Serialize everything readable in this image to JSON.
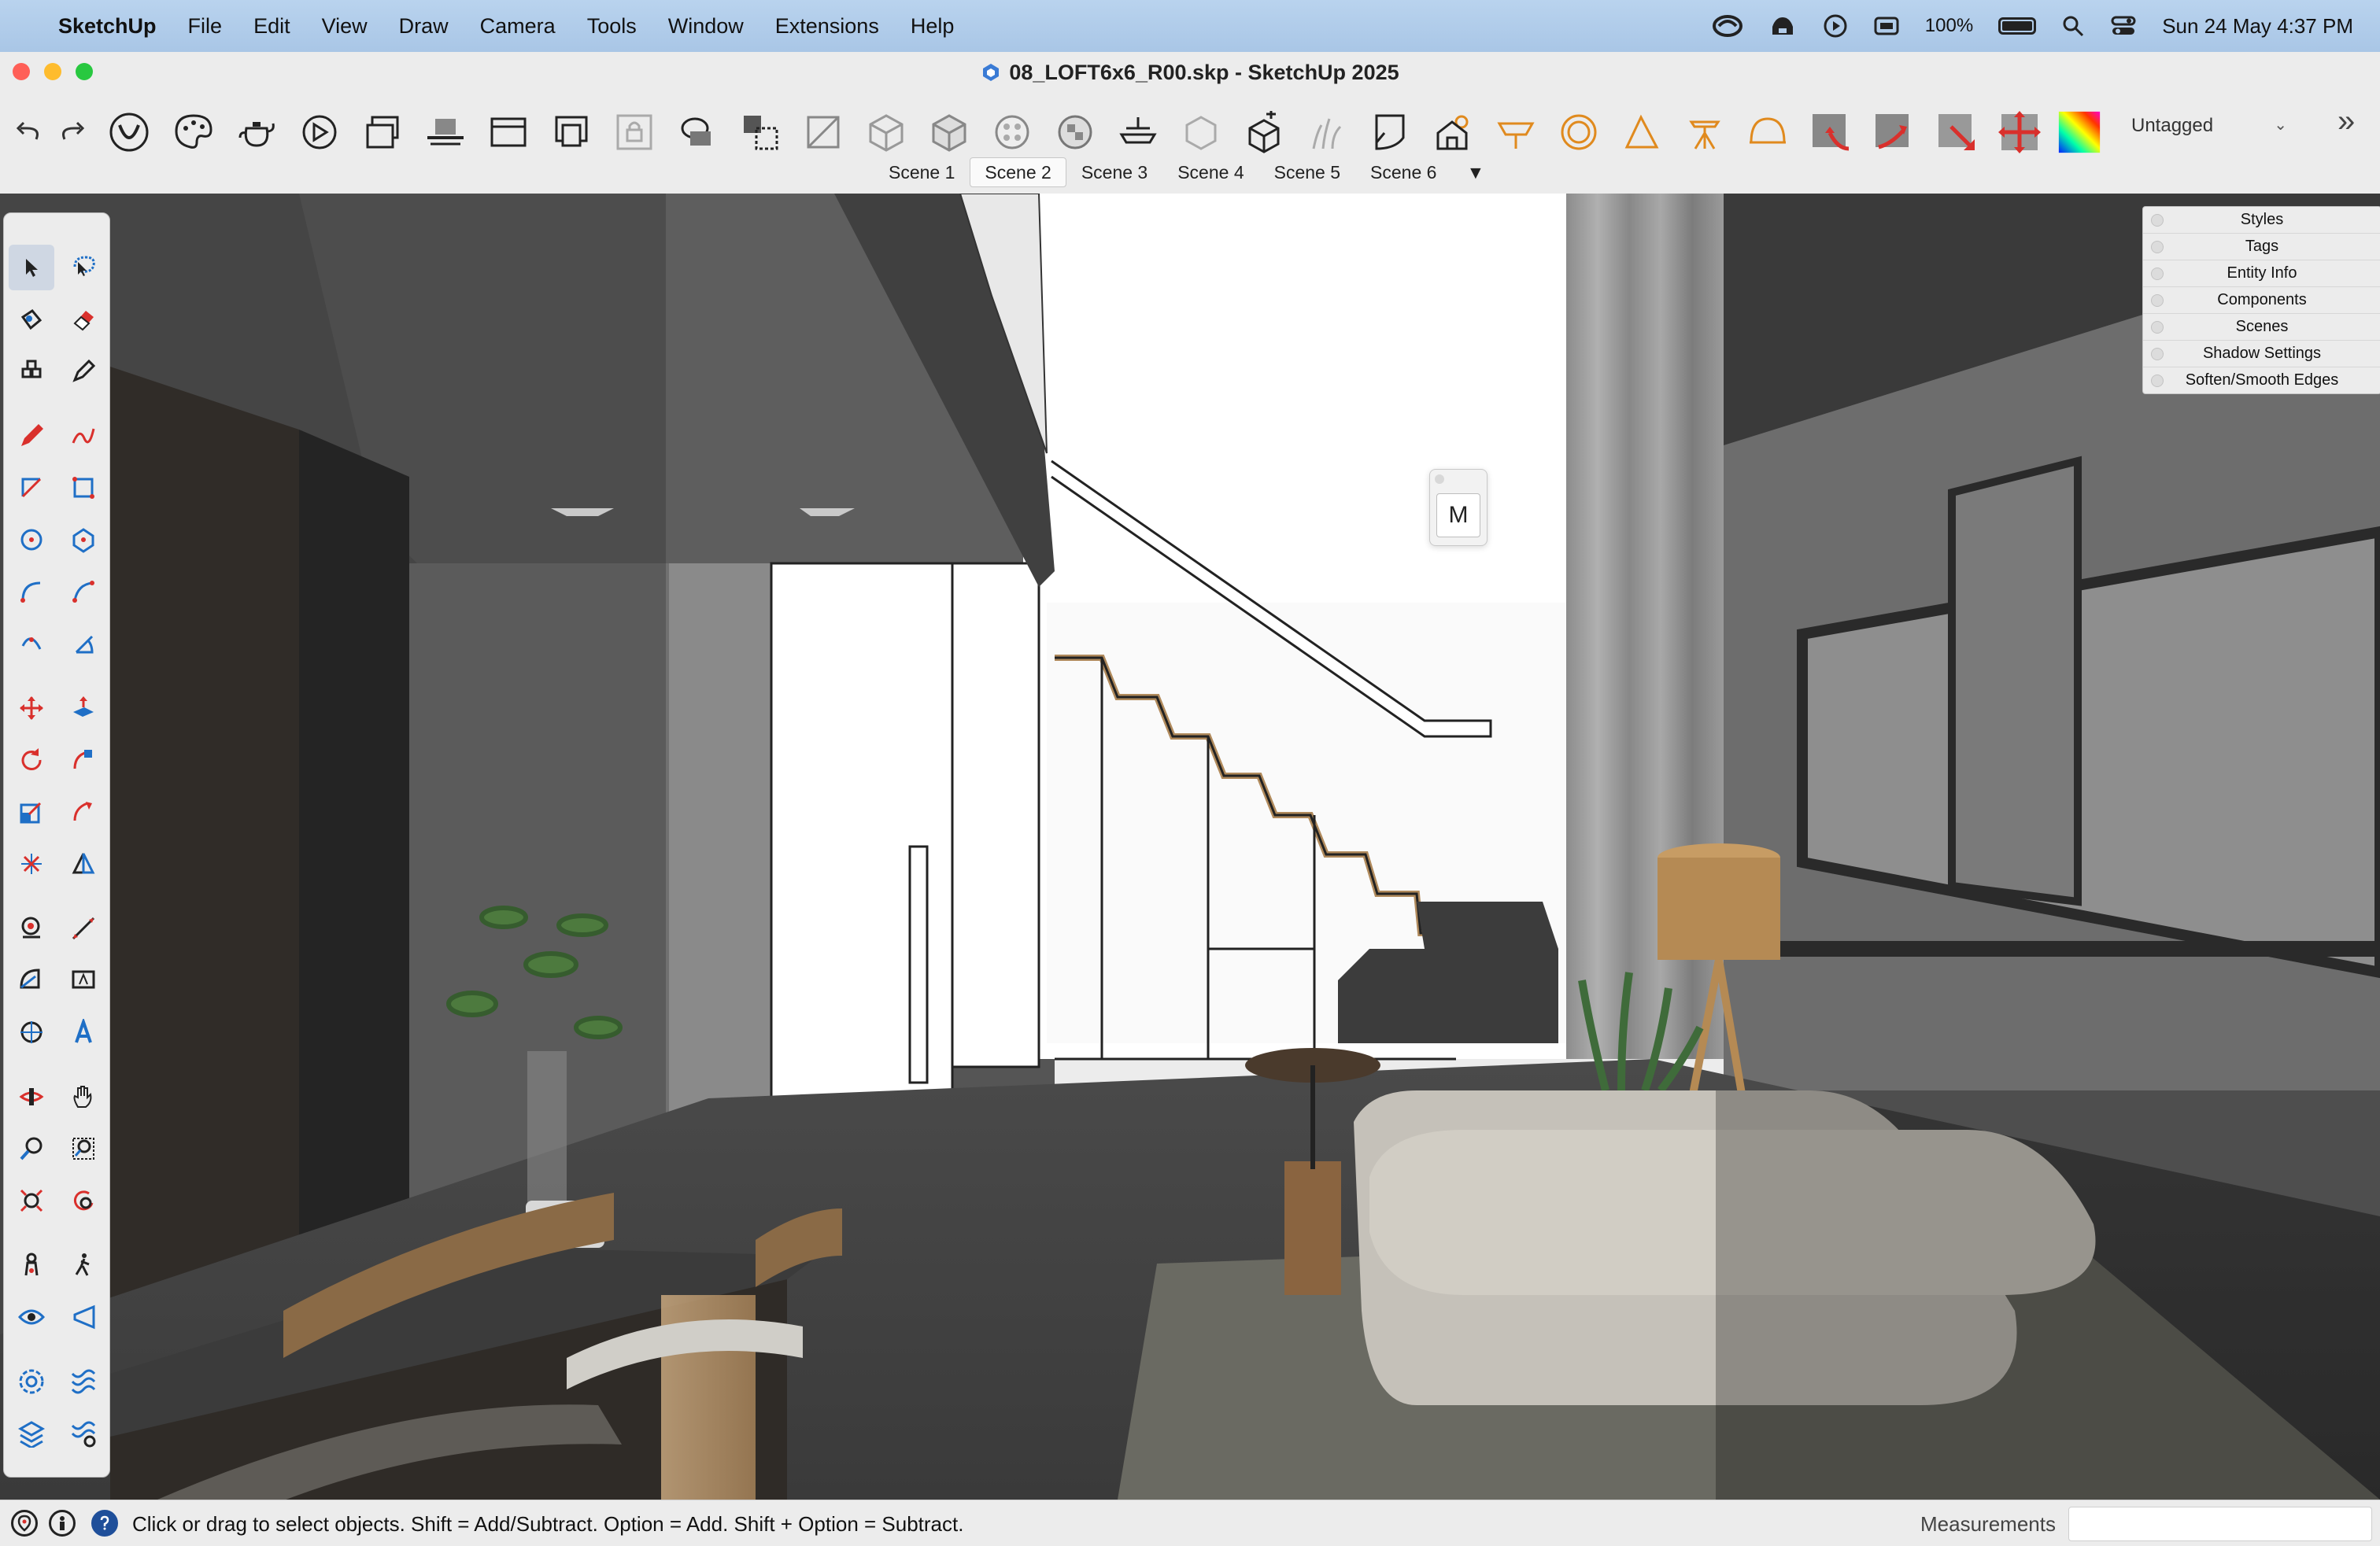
{
  "menubar": {
    "app_name": "SketchUp",
    "menus": [
      "File",
      "Edit",
      "View",
      "Draw",
      "Camera",
      "Tools",
      "Window",
      "Extensions",
      "Help"
    ],
    "battery_percent": "100%",
    "datetime": "Sun 24 May  4:37 PM"
  },
  "window": {
    "title": "08_LOFT6x6_R00.skp - SketchUp 2025"
  },
  "toolbar": {
    "tag_dropdown_value": "Untagged"
  },
  "scenes": {
    "tabs": [
      "Scene 1",
      "Scene 2",
      "Scene 3",
      "Scene 4",
      "Scene 5",
      "Scene 6"
    ],
    "active": "Scene 2",
    "more": "▼"
  },
  "tray": {
    "items": [
      "Styles",
      "Tags",
      "Entity Info",
      "Components",
      "Scenes",
      "Shadow Settings",
      "Soften/Smooth Edges"
    ]
  },
  "floating_panel": {
    "button_label": "M"
  },
  "status": {
    "hint": "Click or drag to select objects. Shift = Add/Subtract. Option = Add. Shift + Option = Subtract.",
    "measurements_label": "Measurements",
    "measurements_value": ""
  },
  "colors": {
    "menubar_bg": "#b3cdea",
    "window_chrome": "#ececec",
    "accent_red": "#d9302c",
    "selected_tool_bg": "#cfd7e3"
  }
}
